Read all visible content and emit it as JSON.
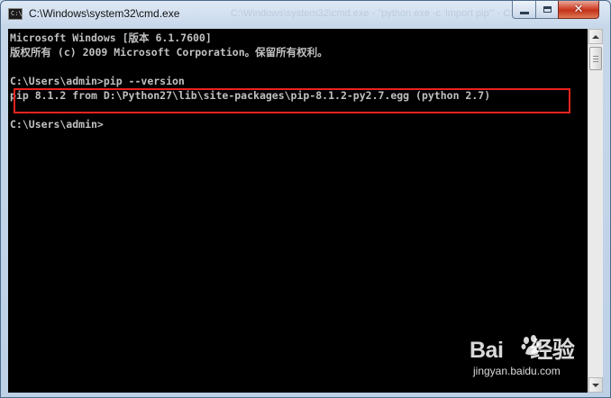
{
  "window": {
    "title": "C:\\Windows\\system32\\cmd.exe",
    "background_title_text": "C:\\Windows\\system32\\cmd.exe - \"python.exe -c 'import pip'\" - C:\\...",
    "icon_label": "C:\\_"
  },
  "controls": {
    "close_glyph": "✕"
  },
  "console": {
    "lines": [
      "Microsoft Windows [版本 6.1.7600]",
      "版权所有 (c) 2009 Microsoft Corporation。保留所有权利。",
      "",
      "C:\\Users\\admin>pip --version",
      "pip 8.1.2 from D:\\Python27\\lib\\site-packages\\pip-8.1.2-py2.7.egg (python 2.7)",
      "",
      "C:\\Users\\admin>"
    ]
  },
  "watermark": {
    "logo_text_left": "Bai",
    "logo_text_right": "经验",
    "site": "jingyan.baidu.com"
  },
  "colors": {
    "console_bg": "#000000",
    "console_text": "#c0c0c0",
    "highlight_border": "#e8231e",
    "close_button": "#c4321b"
  }
}
